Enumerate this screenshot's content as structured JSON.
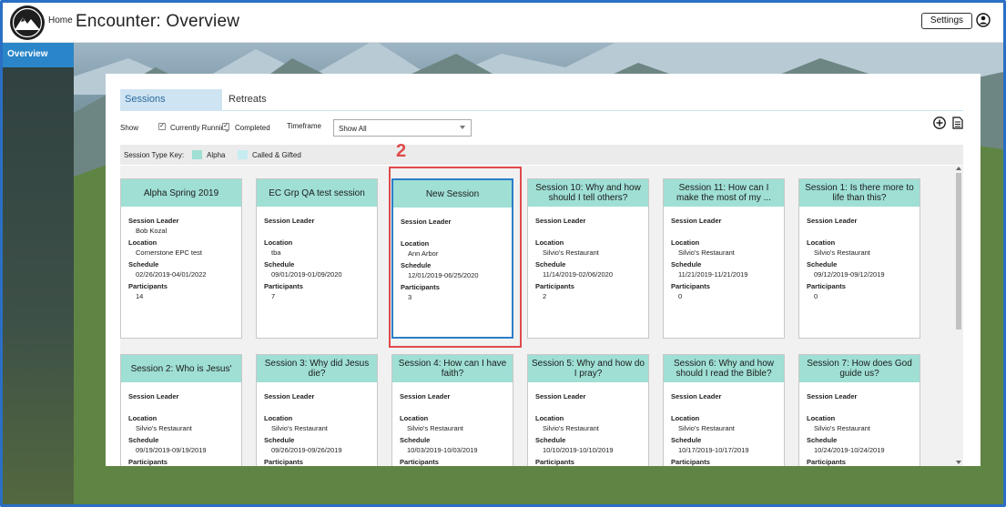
{
  "header": {
    "home_label": "Home",
    "title": "Encounter: Overview",
    "settings_label": "Settings"
  },
  "sidebar": {
    "items": [
      {
        "label": "Overview",
        "active": true
      }
    ]
  },
  "tabs": [
    {
      "label": "Sessions",
      "active": true
    },
    {
      "label": "Retreats",
      "active": false
    }
  ],
  "filters": {
    "show_label": "Show",
    "currently_running": {
      "label": "Currently Running",
      "checked": true
    },
    "completed": {
      "label": "Completed",
      "checked": true
    },
    "timeframe_label": "Timeframe",
    "timeframe_value": "Show All"
  },
  "key": {
    "label": "Session Type Key:",
    "alpha_label": "Alpha",
    "alpha_color": "#9fdfd4",
    "called_label": "Called & Gifted",
    "called_color": "#c6ecf2"
  },
  "field_labels": {
    "leader": "Session Leader",
    "location": "Location",
    "schedule": "Schedule",
    "participants": "Participants"
  },
  "annotation": {
    "step": "2",
    "color": "#e04a4a"
  },
  "cards": [
    {
      "title": "Alpha Spring 2019",
      "leader": "Bob Kozal",
      "location": "Cornerstone EPC test",
      "schedule": "02/26/2019-04/01/2022",
      "participants": "14"
    },
    {
      "title": "EC Grp QA test session",
      "leader": "",
      "location": "tba",
      "schedule": "09/01/2019-01/09/2020",
      "participants": "7"
    },
    {
      "title": "New Session",
      "leader": "",
      "location": "Ann Arbor",
      "schedule": "12/01/2019-06/25/2020",
      "participants": "3"
    },
    {
      "title": "Session 10: Why and how should I tell others?",
      "leader": "",
      "location": "Silvio's Restaurant",
      "schedule": "11/14/2019-02/06/2020",
      "participants": "2"
    },
    {
      "title": "Session 11: How can I make the most of my  ...",
      "leader": "",
      "location": "Silvio's Restaurant",
      "schedule": "11/21/2019-11/21/2019",
      "participants": "0"
    },
    {
      "title": "Session 1: Is there more to life than this?",
      "leader": "",
      "location": "Silvio's Restaurant",
      "schedule": "09/12/2019-09/12/2019",
      "participants": "0"
    },
    {
      "title": "Session 2: Who is Jesus'",
      "leader": "",
      "location": "Silvio's Restaurant",
      "schedule": "09/19/2019-09/19/2019",
      "participants": ""
    },
    {
      "title": "Session 3: Why did Jesus die?",
      "leader": "",
      "location": "Silvio's Restaurant",
      "schedule": "09/26/2019-09/26/2019",
      "participants": ""
    },
    {
      "title": "Session 4: How can I have faith?",
      "leader": "",
      "location": "Silvio's Restaurant",
      "schedule": "10/03/2019-10/03/2019",
      "participants": ""
    },
    {
      "title": "Session 5: Why and how do I pray?",
      "leader": "",
      "location": "Silvio's Restaurant",
      "schedule": "10/10/2019-10/10/2019",
      "participants": ""
    },
    {
      "title": "Session 6: Why and how should I read the Bible?",
      "leader": "",
      "location": "Silvio's Restaurant",
      "schedule": "10/17/2019-10/17/2019",
      "participants": ""
    },
    {
      "title": "Session 7: How does God guide us?",
      "leader": "",
      "location": "Silvio's Restaurant",
      "schedule": "10/24/2019-10/24/2019",
      "participants": ""
    }
  ]
}
